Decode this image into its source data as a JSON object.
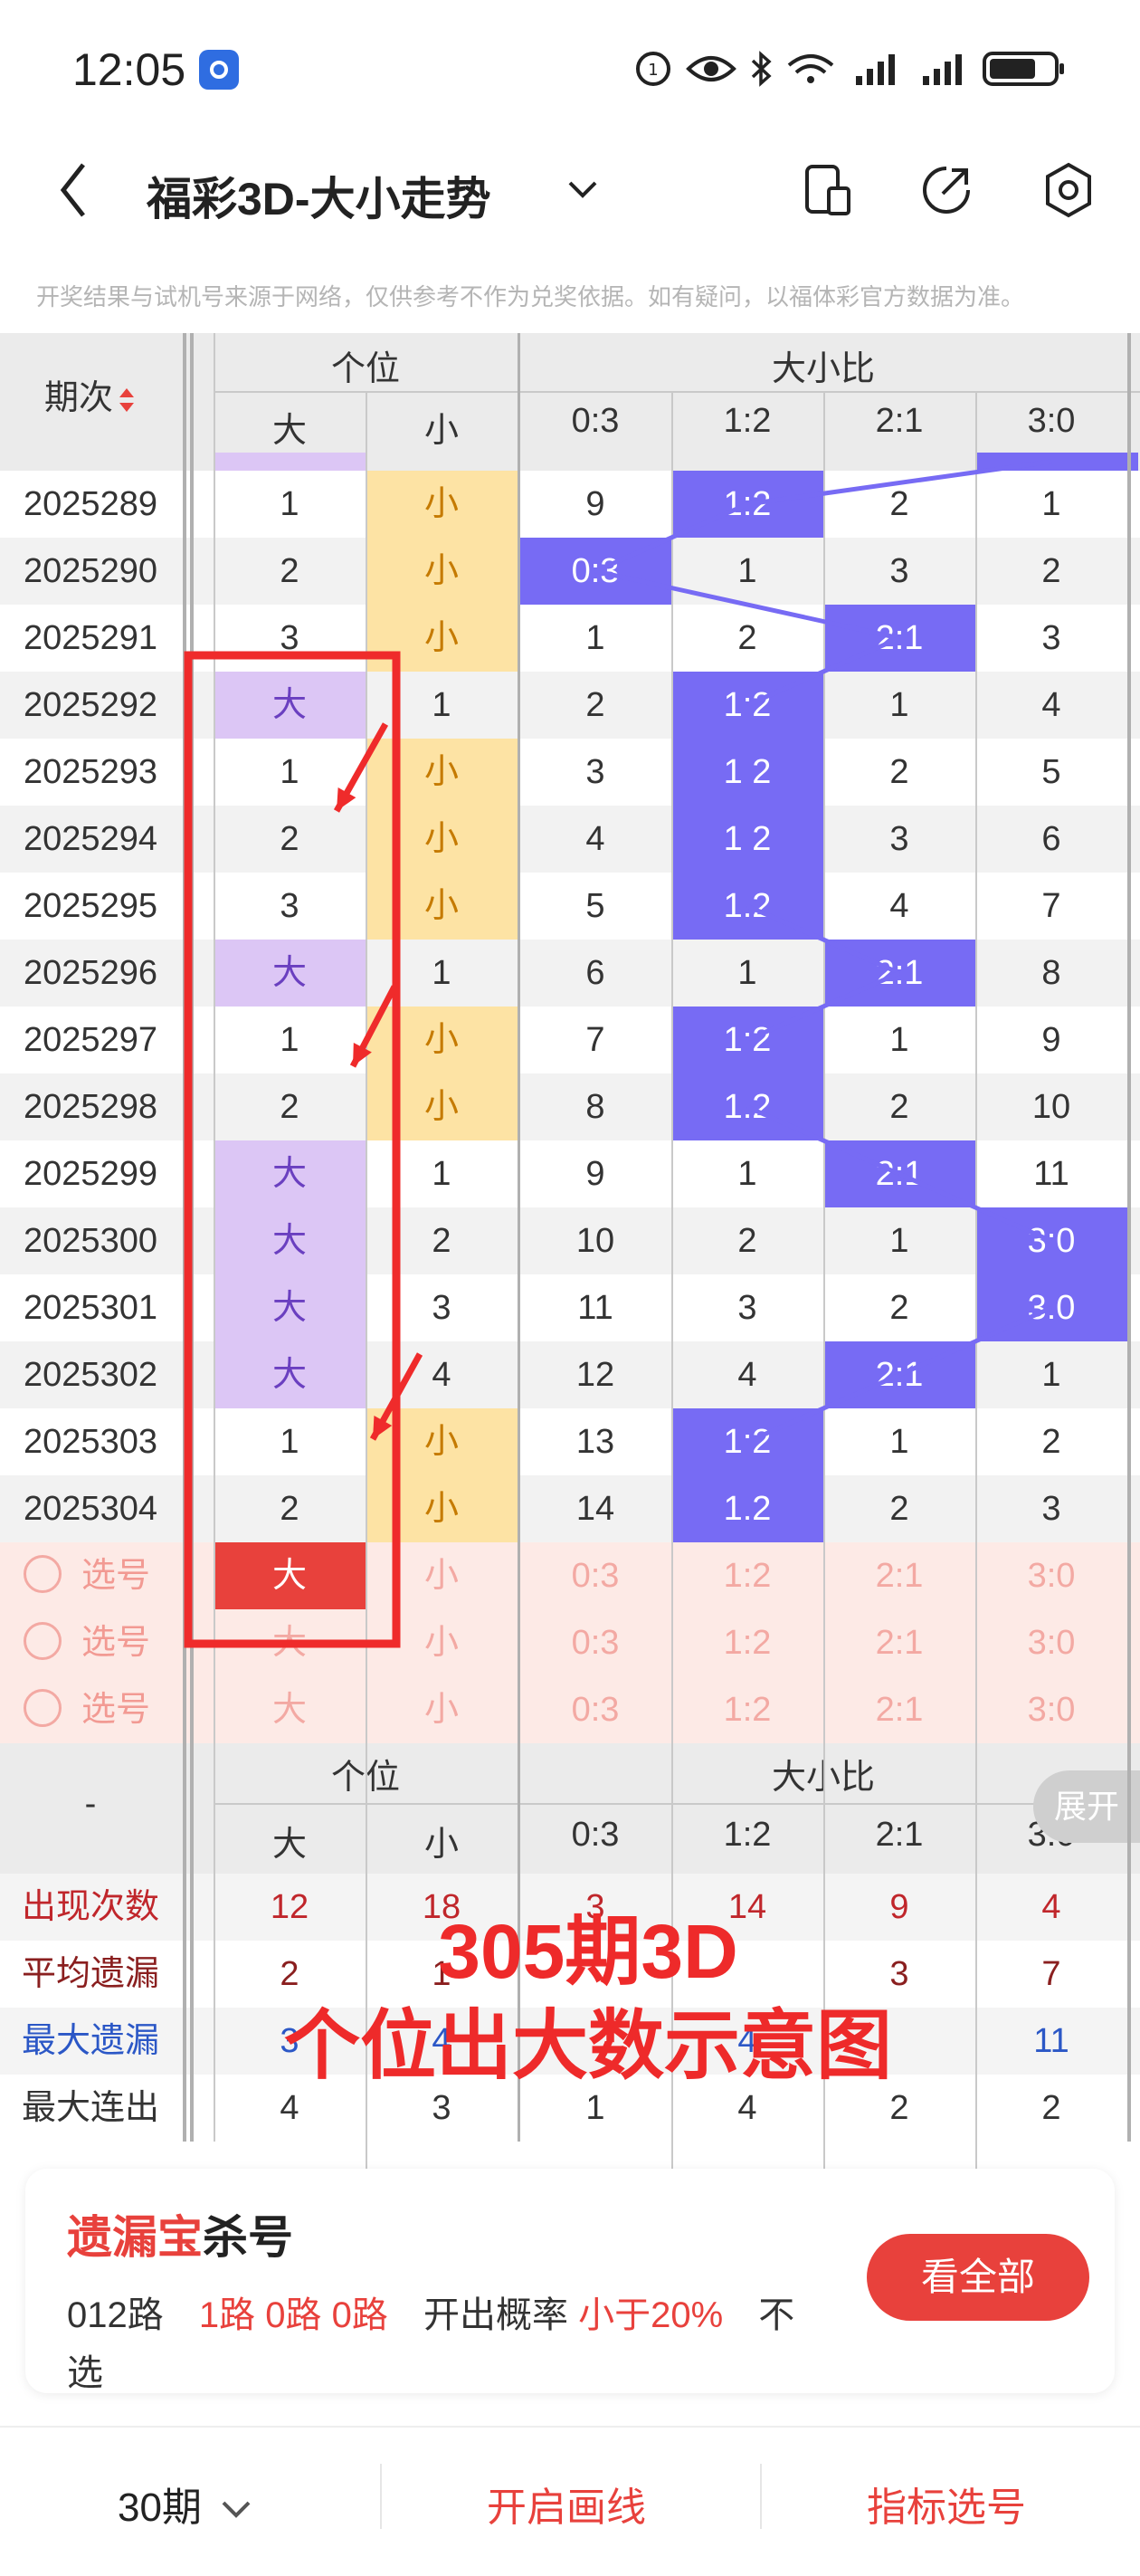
{
  "status_bar": {
    "time": "12:05"
  },
  "header": {
    "title": "福彩3D-大小走势"
  },
  "notice": "开奖结果与试机号来源于网络，仅供参考不作为兑奖依据。如有疑问，以福体彩官方数据为准。",
  "table": {
    "issue_header": "期次",
    "group1": "个位",
    "group2": "大小比",
    "sub_headers": [
      "大",
      "小",
      "0:3",
      "1:2",
      "2:1",
      "3:0"
    ],
    "rows": [
      {
        "issue": "2025289",
        "cells": [
          "1",
          "小",
          "9",
          "1:2",
          "2",
          "1"
        ],
        "hit": [
          1,
          3
        ]
      },
      {
        "issue": "2025290",
        "cells": [
          "2",
          "小",
          "0:3",
          "1",
          "3",
          "2"
        ],
        "hit": [
          1,
          2
        ]
      },
      {
        "issue": "2025291",
        "cells": [
          "3",
          "小",
          "1",
          "2",
          "2:1",
          "3"
        ],
        "hit": [
          1,
          4
        ]
      },
      {
        "issue": "2025292",
        "cells": [
          "大",
          "1",
          "2",
          "1:2",
          "1",
          "4"
        ],
        "hit": [
          0,
          3
        ]
      },
      {
        "issue": "2025293",
        "cells": [
          "1",
          "小",
          "3",
          "1:2",
          "2",
          "5"
        ],
        "hit": [
          1,
          3
        ]
      },
      {
        "issue": "2025294",
        "cells": [
          "2",
          "小",
          "4",
          "1:2",
          "3",
          "6"
        ],
        "hit": [
          1,
          3
        ]
      },
      {
        "issue": "2025295",
        "cells": [
          "3",
          "小",
          "5",
          "1:2",
          "4",
          "7"
        ],
        "hit": [
          1,
          3
        ]
      },
      {
        "issue": "2025296",
        "cells": [
          "大",
          "1",
          "6",
          "1",
          "2:1",
          "8"
        ],
        "hit": [
          0,
          4
        ]
      },
      {
        "issue": "2025297",
        "cells": [
          "1",
          "小",
          "7",
          "1:2",
          "1",
          "9"
        ],
        "hit": [
          1,
          3
        ]
      },
      {
        "issue": "2025298",
        "cells": [
          "2",
          "小",
          "8",
          "1:2",
          "2",
          "10"
        ],
        "hit": [
          1,
          3
        ]
      },
      {
        "issue": "2025299",
        "cells": [
          "大",
          "1",
          "9",
          "1",
          "2:1",
          "11"
        ],
        "hit": [
          0,
          4
        ]
      },
      {
        "issue": "2025300",
        "cells": [
          "大",
          "2",
          "10",
          "2",
          "1",
          "3:0"
        ],
        "hit": [
          0,
          5
        ]
      },
      {
        "issue": "2025301",
        "cells": [
          "大",
          "3",
          "11",
          "3",
          "2",
          "3:0"
        ],
        "hit": [
          0,
          5
        ]
      },
      {
        "issue": "2025302",
        "cells": [
          "大",
          "4",
          "12",
          "4",
          "2:1",
          "1"
        ],
        "hit": [
          0,
          4
        ]
      },
      {
        "issue": "2025303",
        "cells": [
          "1",
          "小",
          "13",
          "1:2",
          "1",
          "2"
        ],
        "hit": [
          1,
          3
        ]
      },
      {
        "issue": "2025304",
        "cells": [
          "2",
          "小",
          "14",
          "1:2",
          "2",
          "3"
        ],
        "hit": [
          1,
          3
        ]
      }
    ],
    "select_label": "选号",
    "select_rows": [
      {
        "cells": [
          "大",
          "小",
          "0:3",
          "1:2",
          "2:1",
          "3:0"
        ],
        "selected": 0
      },
      {
        "cells": [
          "大",
          "小",
          "0:3",
          "1:2",
          "2:1",
          "3:0"
        ],
        "selected": -1
      },
      {
        "cells": [
          "大",
          "小",
          "0:3",
          "1:2",
          "2:1",
          "3:0"
        ],
        "selected": -1
      }
    ],
    "footer_dash": "-",
    "expand_label": "展开",
    "stats": [
      {
        "label": "出现次数",
        "color": "#c0262b",
        "values": [
          "12",
          "18",
          "3",
          "14",
          "9",
          "4"
        ]
      },
      {
        "label": "平均遗漏",
        "color": "#8a1f1f",
        "values": [
          "2",
          "1",
          "",
          "",
          "3",
          "7"
        ]
      },
      {
        "label": "最大遗漏",
        "color": "#2b57c6",
        "values": [
          "3",
          "4",
          "",
          "4",
          "",
          "11"
        ]
      },
      {
        "label": "最大连出",
        "color": "#333333",
        "values": [
          "4",
          "3",
          "1",
          "4",
          "2",
          "2"
        ]
      }
    ]
  },
  "overlay": {
    "line1": "305期3D",
    "line2": "个位出大数示意图"
  },
  "card": {
    "title_red": "遗漏宝",
    "title_black": "杀号",
    "road_label": "012路",
    "road_values": "1路 0路 0路",
    "prob_label": "开出概率",
    "prob_value": "小于20%",
    "tail": "不",
    "tail2": "选",
    "button": "看全部"
  },
  "bottom_bar": {
    "period": "30期",
    "draw": "开启画线",
    "indicator": "指标选号"
  },
  "colors": {
    "purple_light": "#dcc6f5",
    "yellow": "#fde3a4",
    "blue": "#776bf4",
    "red": "#e8413c"
  }
}
